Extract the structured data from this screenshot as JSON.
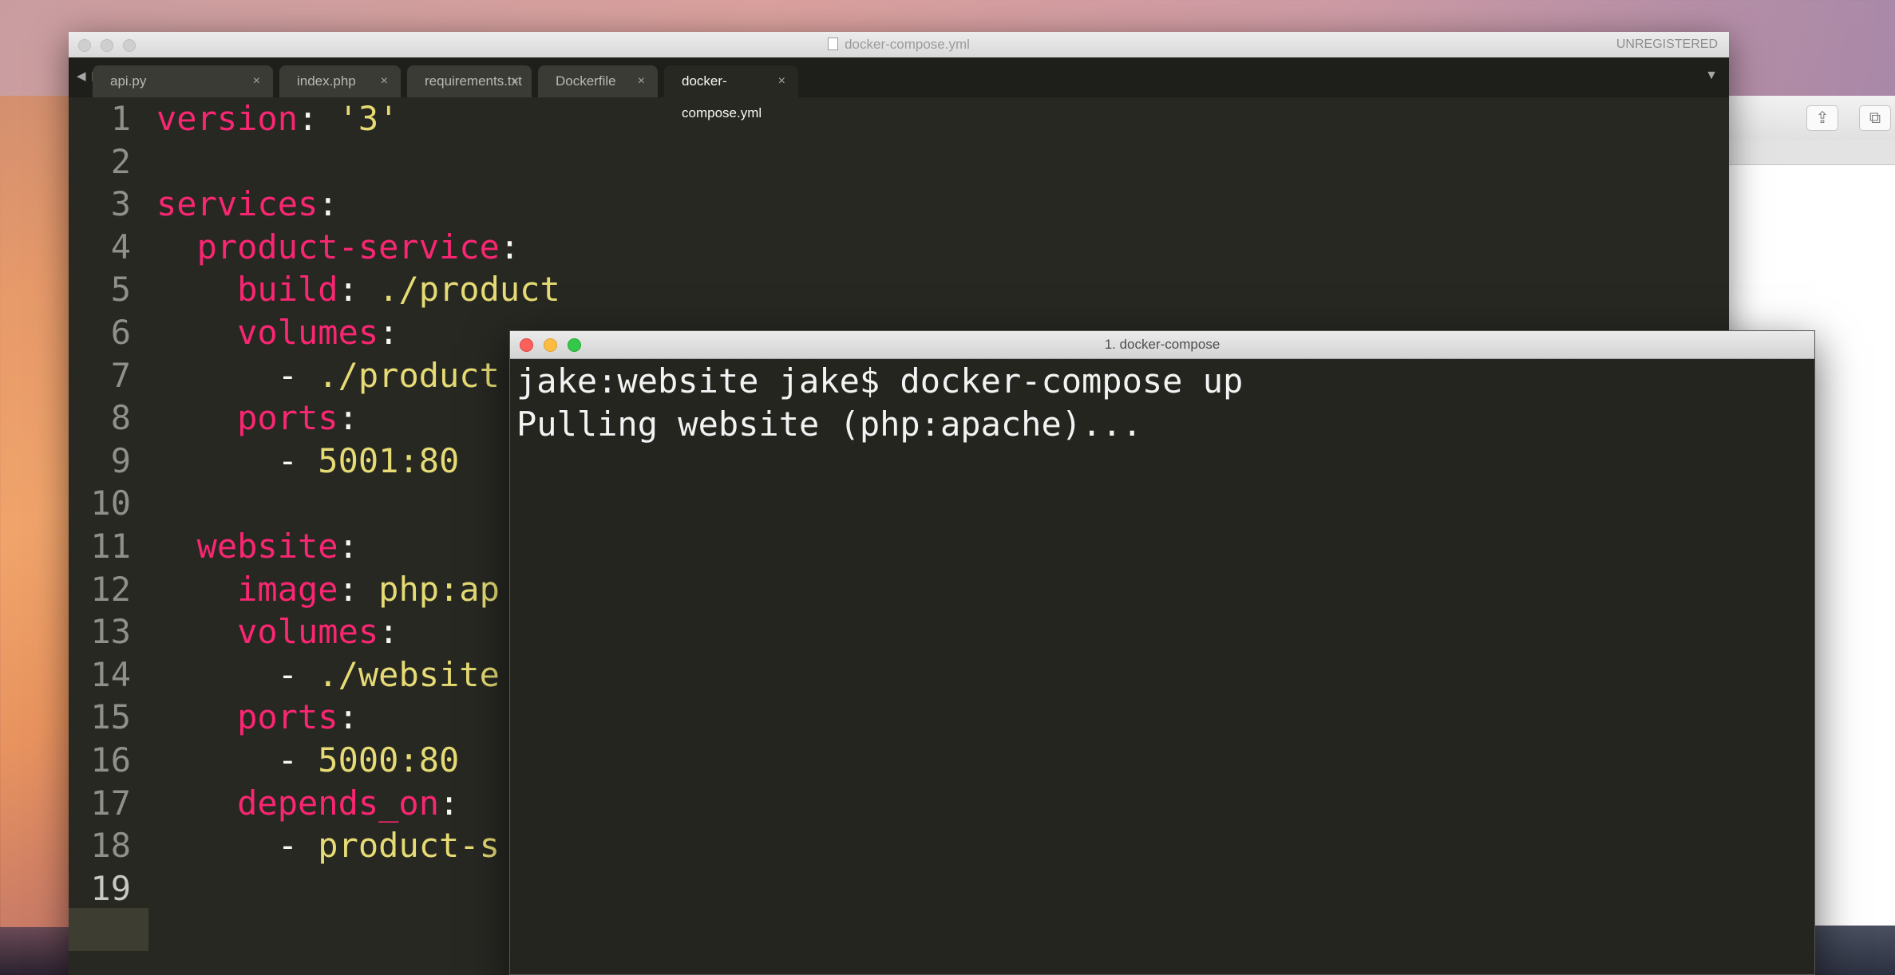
{
  "editor": {
    "title": "docker-compose.yml",
    "license_status": "UNREGISTERED",
    "tabs": [
      {
        "label": "api.py",
        "active": false
      },
      {
        "label": "index.php",
        "active": false
      },
      {
        "label": "requirements.txt",
        "active": false
      },
      {
        "label": "Dockerfile",
        "active": false
      },
      {
        "label": "docker-compose.yml",
        "active": true
      }
    ],
    "close_glyph": "×",
    "lines": [
      {
        "n": "1",
        "tokens": [
          {
            "t": "version",
            "c": "k"
          },
          {
            "t": ": ",
            "c": "p"
          },
          {
            "t": "'3'",
            "c": "s"
          }
        ]
      },
      {
        "n": "2",
        "tokens": []
      },
      {
        "n": "3",
        "tokens": [
          {
            "t": "services",
            "c": "k"
          },
          {
            "t": ":",
            "c": "p"
          }
        ]
      },
      {
        "n": "4",
        "tokens": [
          {
            "t": "  product-service",
            "c": "k"
          },
          {
            "t": ":",
            "c": "p"
          }
        ]
      },
      {
        "n": "5",
        "tokens": [
          {
            "t": "    build",
            "c": "k"
          },
          {
            "t": ": ",
            "c": "p"
          },
          {
            "t": "./product",
            "c": "n"
          }
        ]
      },
      {
        "n": "6",
        "tokens": [
          {
            "t": "    volumes",
            "c": "k"
          },
          {
            "t": ":",
            "c": "p"
          }
        ]
      },
      {
        "n": "7",
        "tokens": [
          {
            "t": "      - ",
            "c": "p"
          },
          {
            "t": "./product",
            "c": "n"
          }
        ]
      },
      {
        "n": "8",
        "tokens": [
          {
            "t": "    ports",
            "c": "k"
          },
          {
            "t": ":",
            "c": "p"
          }
        ]
      },
      {
        "n": "9",
        "tokens": [
          {
            "t": "      - ",
            "c": "p"
          },
          {
            "t": "5001:80",
            "c": "n"
          }
        ]
      },
      {
        "n": "10",
        "tokens": []
      },
      {
        "n": "11",
        "tokens": [
          {
            "t": "  website",
            "c": "k"
          },
          {
            "t": ":",
            "c": "p"
          }
        ]
      },
      {
        "n": "12",
        "tokens": [
          {
            "t": "    image",
            "c": "k"
          },
          {
            "t": ": ",
            "c": "p"
          },
          {
            "t": "php:ap",
            "c": "n"
          }
        ]
      },
      {
        "n": "13",
        "tokens": [
          {
            "t": "    volumes",
            "c": "k"
          },
          {
            "t": ":",
            "c": "p"
          }
        ]
      },
      {
        "n": "14",
        "tokens": [
          {
            "t": "      - ",
            "c": "p"
          },
          {
            "t": "./website",
            "c": "n"
          }
        ]
      },
      {
        "n": "15",
        "tokens": [
          {
            "t": "    ports",
            "c": "k"
          },
          {
            "t": ":",
            "c": "p"
          }
        ]
      },
      {
        "n": "16",
        "tokens": [
          {
            "t": "      - ",
            "c": "p"
          },
          {
            "t": "5000:80",
            "c": "n"
          }
        ]
      },
      {
        "n": "17",
        "tokens": [
          {
            "t": "    depends_on",
            "c": "k"
          },
          {
            "t": ":",
            "c": "p"
          }
        ]
      },
      {
        "n": "18",
        "tokens": [
          {
            "t": "      - ",
            "c": "p"
          },
          {
            "t": "product-s",
            "c": "n"
          }
        ]
      },
      {
        "n": "19",
        "tokens": []
      }
    ],
    "current_line": "19"
  },
  "terminal": {
    "title": "1. docker-compose",
    "output": "jake:website jake$ docker-compose up\nPulling website (php:apache)..."
  },
  "colors": {
    "keyword": "#f92672",
    "string": "#e6db74",
    "editor_bg": "#272822",
    "terminal_bg": "#252520"
  }
}
